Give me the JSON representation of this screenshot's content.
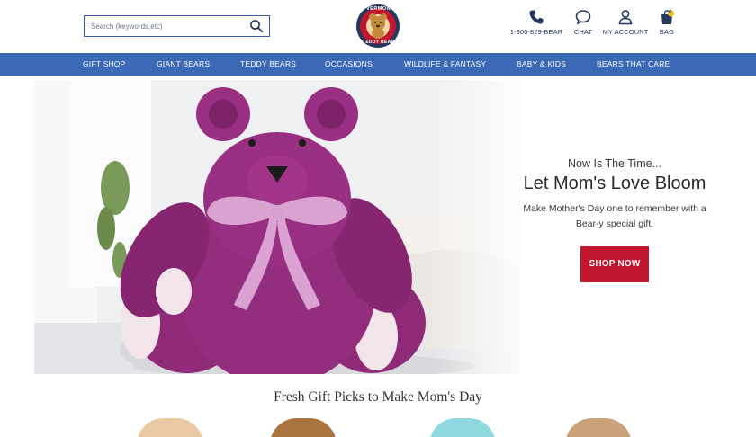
{
  "header": {
    "search": {
      "placeholder": "Search (keywords,etc)",
      "value": ""
    },
    "logo_text_top": "VERMONT",
    "logo_text_bottom": "TEDDY BEAR",
    "phone_label": "1-800-829-BEAR",
    "chat_label": "CHAT",
    "account_label": "MY ACCOUNT",
    "bag_label": "BAG",
    "bag_count": "0"
  },
  "nav": {
    "items": [
      "GIFT SHOP",
      "GIANT BEARS",
      "TEDDY BEARS",
      "OCCASIONS",
      "WILDLIFE & FANTASY",
      "BABY & KIDS",
      "BEARS THAT CARE"
    ]
  },
  "hero": {
    "eyebrow": "Now Is The Time...",
    "headline": "Let Mom's Love Bloom",
    "subtext_line1": "Make Mother's Day one to remember with a",
    "subtext_line2": "Bear-y special gift.",
    "cta": "SHOP NOW"
  },
  "section": {
    "title": "Fresh Gift Picks to Make Mom's Day"
  },
  "colors": {
    "nav_bg": "#3b69b5",
    "brand_blue": "#23385f",
    "cta_red": "#c0172e",
    "bear_purple": "#8e2a78"
  },
  "icons": {
    "search": "search-icon",
    "phone": "phone-icon",
    "chat": "chat-icon",
    "account": "user-icon",
    "bag": "bag-icon"
  }
}
